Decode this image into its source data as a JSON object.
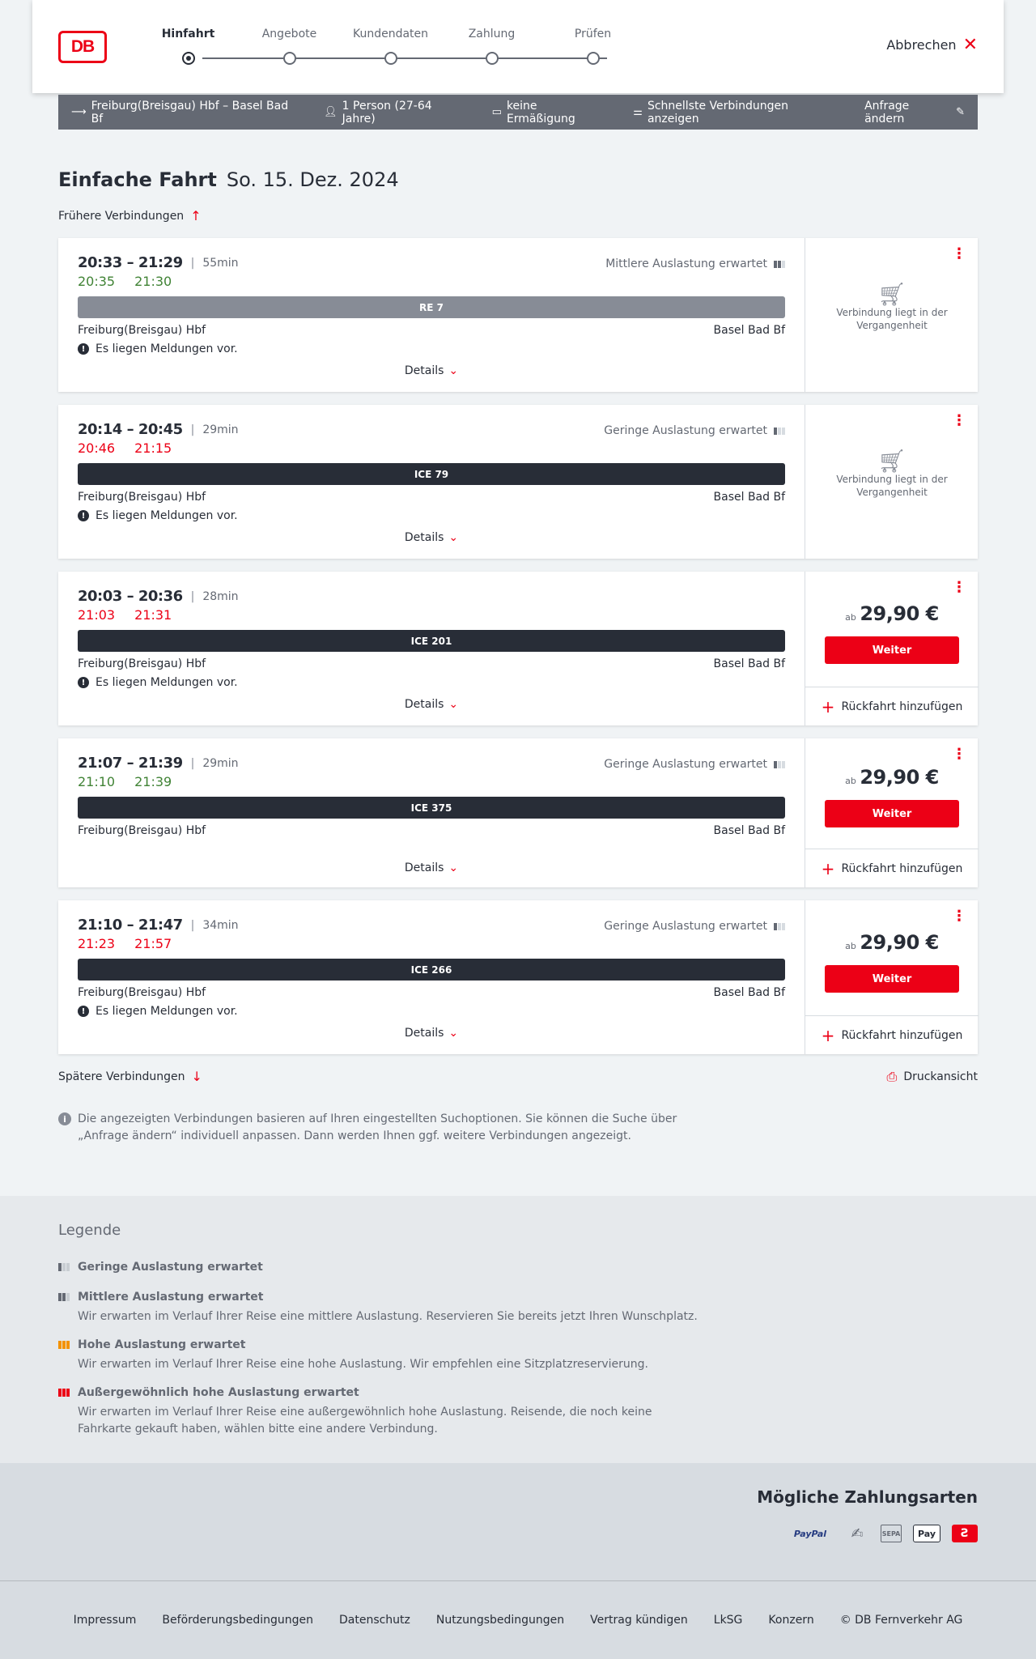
{
  "header": {
    "logo": "DB",
    "steps": [
      {
        "label": "Hinfahrt",
        "active": true
      },
      {
        "label": "Angebote",
        "active": false
      },
      {
        "label": "Kundendaten",
        "active": false
      },
      {
        "label": "Zahlung",
        "active": false
      },
      {
        "label": "Prüfen",
        "active": false
      }
    ],
    "cancel_label": "Abbrechen"
  },
  "summary": {
    "route": "Freiburg(Breisgau) Hbf – Basel Bad Bf",
    "persons": "1 Person (27-64 Jahre)",
    "discount": "keine Ermäßigung",
    "option": "Schnellste Verbindungen anzeigen",
    "change": "Anfrage ändern"
  },
  "title": {
    "main": "Einfache Fahrt",
    "date": "So. 15. Dez. 2024"
  },
  "earlier_label": "Frühere Verbindungen",
  "later_label": "Spätere Verbindungen",
  "print_label": "Druckansicht",
  "connections": [
    {
      "planned": "20:33 – 21:29",
      "duration": "55min",
      "actual_dep": "20:35",
      "actual_arr": "21:30",
      "actual_dep_status": "ontime",
      "actual_arr_status": "ontime",
      "load": "Mittlere Auslastung erwartet",
      "train": "RE 7",
      "train_style": "grey",
      "from": "Freiburg(Breisgau) Hbf",
      "to": "Basel Bad Bf",
      "message": "Es liegen Meldungen vor.",
      "details": "Details",
      "past": "Verbindung liegt in der Vergangenheit"
    },
    {
      "planned": "20:14 – 20:45",
      "duration": "29min",
      "actual_dep": "20:46",
      "actual_arr": "21:15",
      "load": "Geringe Auslastung erwartet",
      "train": "ICE 79",
      "from": "Freiburg(Breisgau) Hbf",
      "to": "Basel Bad Bf",
      "message": "Es liegen Meldungen vor.",
      "details": "Details",
      "past": "Verbindung liegt in der Vergangenheit"
    },
    {
      "planned": "20:03 – 20:36",
      "duration": "28min",
      "actual_dep": "21:03",
      "actual_arr": "21:31",
      "train": "ICE 201",
      "from": "Freiburg(Breisgau) Hbf",
      "to": "Basel Bad Bf",
      "message": "Es liegen Meldungen vor.",
      "details": "Details",
      "price_prefix": "ab",
      "price": "29,90 €",
      "button": "Weiter",
      "return": "Rückfahrt hinzufügen"
    },
    {
      "planned": "21:07 – 21:39",
      "duration": "29min",
      "actual_dep": "21:10",
      "actual_arr": "21:39",
      "load": "Geringe Auslastung erwartet",
      "train": "ICE 375",
      "from": "Freiburg(Breisgau) Hbf",
      "to": "Basel Bad Bf",
      "details": "Details",
      "price_prefix": "ab",
      "price": "29,90 €",
      "button": "Weiter",
      "return": "Rückfahrt hinzufügen"
    },
    {
      "planned": "21:10 – 21:47",
      "duration": "34min",
      "actual_dep": "21:23",
      "actual_arr": "21:57",
      "load": "Geringe Auslastung erwartet",
      "train": "ICE 266",
      "from": "Freiburg(Breisgau) Hbf",
      "to": "Basel Bad Bf",
      "message": "Es liegen Meldungen vor.",
      "details": "Details",
      "price_prefix": "ab",
      "price": "29,90 €",
      "button": "Weiter",
      "return": "Rückfahrt hinzufügen"
    }
  ],
  "info_text": "Die angezeigten Verbindungen basieren auf Ihren eingestellten Suchoptionen. Sie können die Suche über „Anfrage ändern“ individuell anpassen. Dann werden Ihnen ggf. weitere Verbindungen angezeigt.",
  "legend": {
    "title": "Legende",
    "items": [
      {
        "title": "Geringe Auslastung erwartet",
        "desc": ""
      },
      {
        "title": "Mittlere Auslastung erwartet",
        "desc": "Wir erwarten im Verlauf Ihrer Reise eine mittlere Auslastung. Reservieren Sie bereits jetzt Ihren Wunschplatz."
      },
      {
        "title": "Hohe Auslastung erwartet",
        "desc": "Wir erwarten im Verlauf Ihrer Reise eine hohe Auslastung. Wir empfehlen eine Sitzplatzreservierung."
      },
      {
        "title": "Außergewöhnlich hohe Auslastung erwartet",
        "desc": "Wir erwarten im Verlauf Ihrer Reise eine außergewöhnlich hohe Auslastung. Reisende, die noch keine Fahrkarte gekauft haben, wählen bitte eine andere Verbindung."
      }
    ]
  },
  "payment": {
    "title": "Mögliche Zahlungsarten",
    "methods": [
      "PayPal",
      "SEPA",
      "Pay"
    ]
  },
  "footer": {
    "links": [
      "Impressum",
      "Beförderungsbedingungen",
      "Datenschutz",
      "Nutzungsbedingungen",
      "Vertrag kündigen",
      "LkSG",
      "Konzern",
      "© DB Fernverkehr AG"
    ]
  },
  "colors": {
    "db_red": "#ec0016",
    "dark": "#282d37",
    "grey": "#646973",
    "ontime_green": "#408335",
    "orange": "#f39200"
  }
}
